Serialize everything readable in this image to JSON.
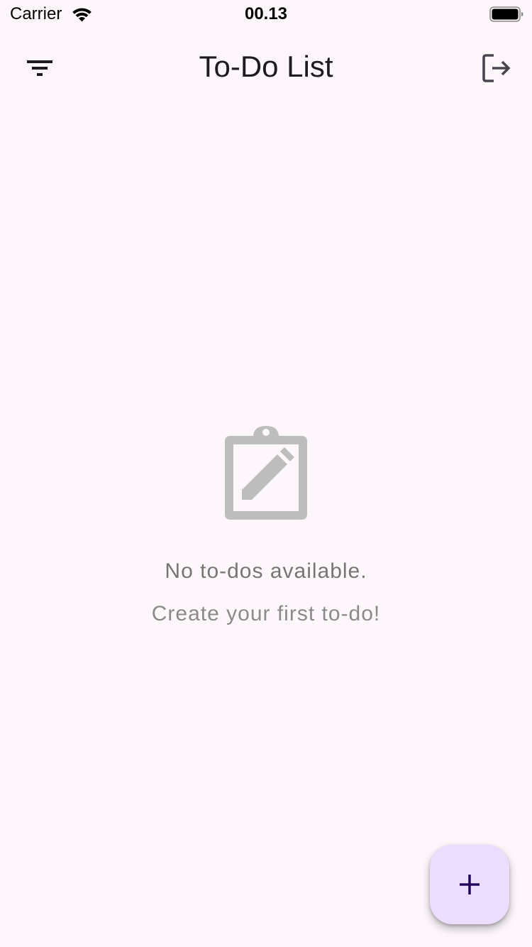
{
  "status_bar": {
    "carrier": "Carrier",
    "time": "00.13",
    "wifi_icon": "wifi-icon",
    "battery_icon": "battery-full-icon"
  },
  "app_bar": {
    "title": "To-Do List",
    "filter_icon": "filter-list-icon",
    "logout_icon": "logout-icon"
  },
  "empty_state": {
    "icon": "clipboard-edit-icon",
    "title": "No to-dos available.",
    "subtitle": "Create your first to-do!"
  },
  "fab": {
    "icon": "plus-icon"
  },
  "colors": {
    "background": "#fdf7fc",
    "fab_background": "#eaddff",
    "fab_icon": "#21005d",
    "empty_icon": "#bdbdbd",
    "empty_text": "#757575",
    "title_text": "#1d1b20"
  }
}
